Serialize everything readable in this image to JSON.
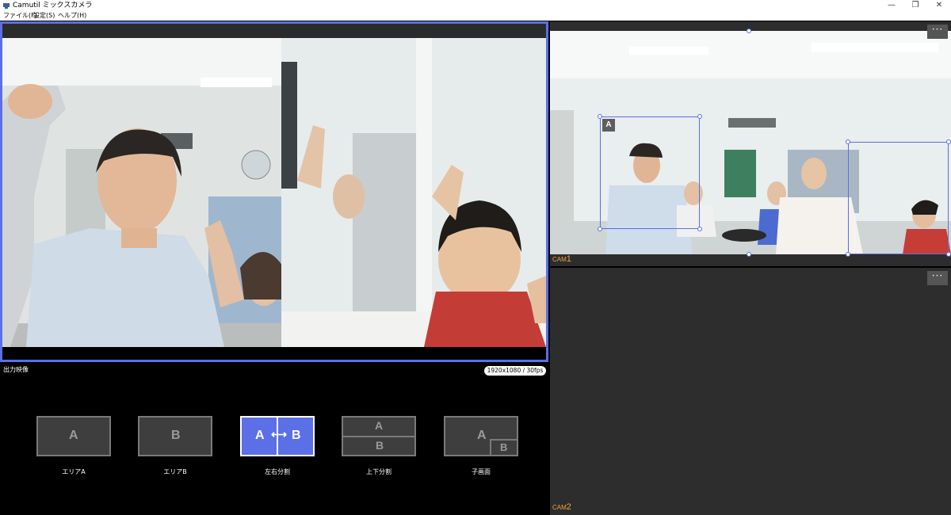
{
  "window": {
    "title": "Camutil ミックスカメラ",
    "minimize": "—",
    "maximize": "❐",
    "close": "✕"
  },
  "menu": [
    "ファイル(F)",
    "設定(S)",
    "ヘルプ(H)"
  ],
  "output": {
    "label": "出力映像",
    "resolution": "1920x1080 / 30fps"
  },
  "modes": [
    {
      "caption": "エリアA",
      "letters": [
        "A"
      ],
      "active": false
    },
    {
      "caption": "エリアB",
      "letters": [
        "B"
      ],
      "active": false
    },
    {
      "caption": "左右分割",
      "letters": [
        "A",
        "⟷",
        "B"
      ],
      "active": true
    },
    {
      "caption": "上下分割",
      "letters": [
        "A",
        "B"
      ],
      "active": false
    },
    {
      "caption": "子画面",
      "letters": [
        "A",
        "B"
      ],
      "active": false
    }
  ],
  "cameras": [
    {
      "prefix": "CAM",
      "number": "1",
      "menu": "···",
      "area_tag": "A"
    },
    {
      "prefix": "CAM",
      "number": "2",
      "menu": "···"
    }
  ],
  "colors": {
    "accent": "#5b6fe6",
    "cam_label": "#f2a23b",
    "pane_bg": "#2d2d2d"
  }
}
